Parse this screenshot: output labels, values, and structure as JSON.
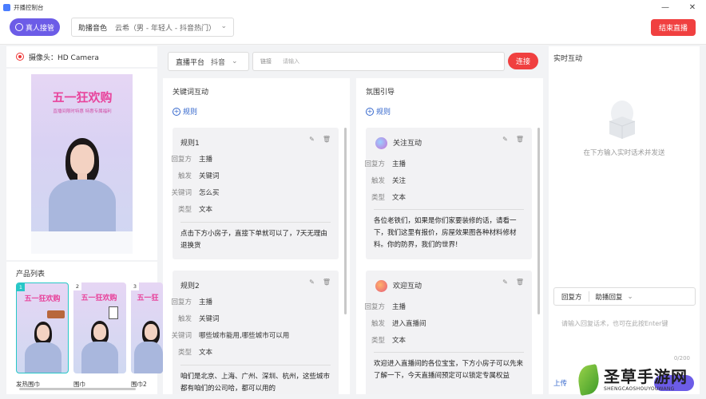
{
  "window": {
    "title": "开播控制台",
    "minimize": "—",
    "close": "✕"
  },
  "header": {
    "live_button": "真人接管",
    "voice_label": "助播音色",
    "voice_value": "云希（男 - 年轻人 - 抖音热门）",
    "end_button": "结束直播",
    "accent": "#6c5ce7",
    "danger": "#f04040"
  },
  "camera": {
    "label": "摄像头：HD Camera",
    "preview_banner": "五一狂欢购",
    "preview_sub": "直播间限时特惠 特惠专属福利"
  },
  "products": {
    "title": "产品列表",
    "items": [
      {
        "index": "1",
        "name": "发热围巾",
        "banner": "五一狂欢购"
      },
      {
        "index": "2",
        "name": "围巾",
        "banner": "五一狂欢购"
      },
      {
        "index": "3",
        "name": "围巾2",
        "banner": "五一狂"
      }
    ]
  },
  "platform": {
    "label": "直播平台",
    "value": "抖音",
    "link_label": "链接",
    "link_placeholder": "请输入",
    "connect_button": "连接"
  },
  "keyword": {
    "title": "关键词互动",
    "add_rule": "规则",
    "rules": [
      {
        "name": "规则1",
        "fields": [
          {
            "k": "回复方",
            "v": "主播"
          },
          {
            "k": "触发",
            "v": "关键词"
          },
          {
            "k": "关键词",
            "v": "怎么买"
          },
          {
            "k": "类型",
            "v": "文本"
          }
        ],
        "text": "点击下方小房子，直接下单就可以了，7天无理由退换货"
      },
      {
        "name": "规则2",
        "fields": [
          {
            "k": "回复方",
            "v": "主播"
          },
          {
            "k": "触发",
            "v": "关键词"
          },
          {
            "k": "关键词",
            "v": "哪些城市能用,哪些城市可以用"
          },
          {
            "k": "类型",
            "v": "文本"
          }
        ],
        "text": "咱们是北京、上海、广州、深圳、杭州，这些城市都有咱们的公司哈，都可以用的"
      }
    ]
  },
  "atmosphere": {
    "title": "氛围引导",
    "add_rule": "规则",
    "rules": [
      {
        "name": "关注互动",
        "icon": "sparkle-icon",
        "fields": [
          {
            "k": "回复方",
            "v": "主播"
          },
          {
            "k": "触发",
            "v": "关注"
          },
          {
            "k": "类型",
            "v": "文本"
          }
        ],
        "text": "各位老铁们，如果是你们家要装修的话，请看一下，我们这里有报价，房屋效果图各种材料修材料。你的防界，我们的世界!"
      },
      {
        "name": "欢迎互动",
        "icon": "heart-icon",
        "fields": [
          {
            "k": "回复方",
            "v": "主播"
          },
          {
            "k": "触发",
            "v": "进入直播间"
          },
          {
            "k": "类型",
            "v": "文本"
          }
        ],
        "text": "欢迎进入直播间的各位宝宝，下方小房子可以先来了解一下，今天直播间预定可以锁定专属权益"
      }
    ]
  },
  "realtime": {
    "title": "实时互动",
    "empty_text": "在下方输入实时话术并发送",
    "reply_label": "回复方",
    "reply_value": "助播回复",
    "input_placeholder": "请输入回复话术，也可在此按Enter键",
    "count": "0/200",
    "upload": "上传"
  },
  "watermark": {
    "text": "圣草手游网",
    "sub": "SHENGCAOSHOUYOUWANG"
  }
}
